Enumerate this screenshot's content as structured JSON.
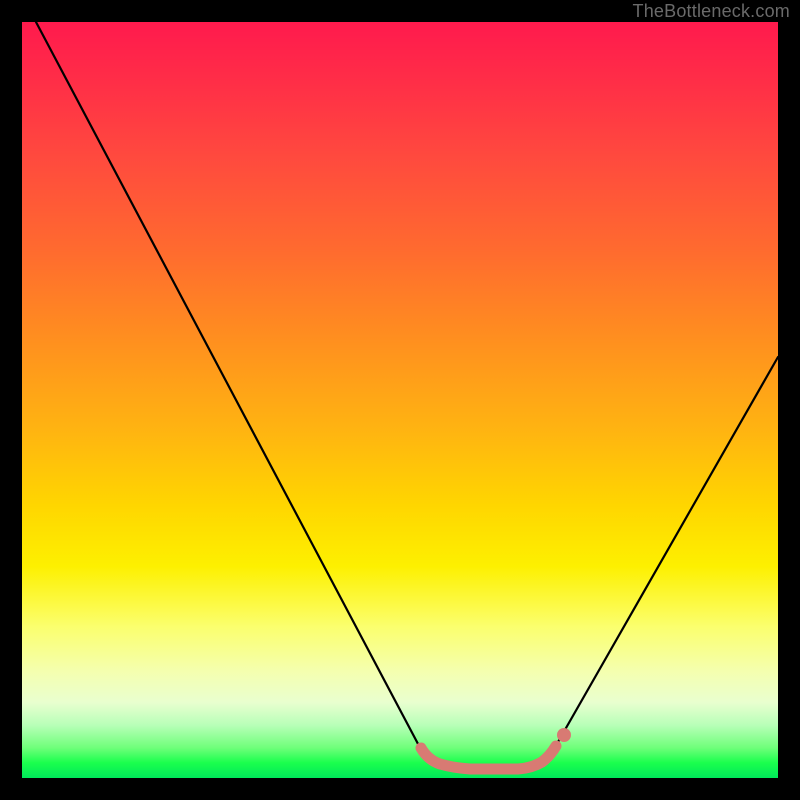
{
  "watermark": "TheBottleneck.com",
  "colors": {
    "frame": "#000000",
    "curve": "#000000",
    "marker": "#d87a73",
    "gradient_top": "#ff1a4d",
    "gradient_bottom": "#00e85a"
  },
  "chart_data": {
    "type": "line",
    "title": "",
    "xlabel": "",
    "ylabel": "",
    "xlim": [
      0,
      100
    ],
    "ylim": [
      0,
      100
    ],
    "x": [
      0,
      5,
      10,
      15,
      20,
      25,
      30,
      35,
      40,
      45,
      50,
      52,
      54,
      56,
      58,
      60,
      62,
      64,
      66,
      68,
      70,
      72,
      75,
      80,
      85,
      90,
      95,
      100
    ],
    "values": [
      100,
      91,
      82,
      73,
      64,
      55,
      46,
      37,
      28,
      19,
      10,
      6,
      3,
      1.5,
      0.8,
      0.5,
      0.5,
      0.5,
      0.8,
      1.5,
      3,
      6,
      12,
      22,
      32,
      41,
      49,
      56
    ],
    "annotations": [
      {
        "label": "flat-minimum-band",
        "x_range": [
          52,
          70
        ],
        "y": 0.5
      }
    ],
    "grid": false,
    "legend": false
  }
}
